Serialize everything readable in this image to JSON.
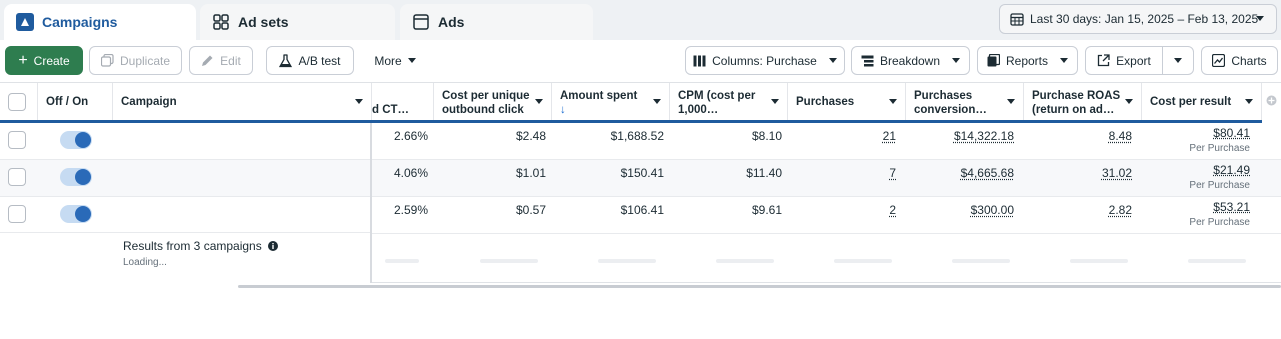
{
  "tabs": [
    {
      "label": "Campaigns",
      "icon": "campaign-icon",
      "active": true
    },
    {
      "label": "Ad sets",
      "icon": "grid-icon",
      "active": false
    },
    {
      "label": "Ads",
      "icon": "ad-icon",
      "active": false
    }
  ],
  "date_range": {
    "label": "Last 30 days: Jan 15, 2025 – Feb 13, 2025"
  },
  "toolbar": {
    "create": "Create",
    "duplicate": "Duplicate",
    "edit": "Edit",
    "ab_test": "A/B test",
    "more": "More",
    "columns": "Columns: Purchase",
    "breakdown": "Breakdown",
    "reports": "Reports",
    "export": "Export",
    "charts": "Charts"
  },
  "columns": {
    "off_on": "Off / On",
    "campaign": "Campaign",
    "ctr_partial": "d CT…",
    "cost_unique_line1": "Cost per unique",
    "cost_unique_line2": "outbound click",
    "amount_spent": "Amount spent",
    "amount_sort": "↓",
    "cpm_line1": "CPM (cost per",
    "cpm_line2": "1,000…",
    "purchases": "Purchases",
    "conv_line1": "Purchases",
    "conv_line2": "conversion…",
    "roas_line1": "Purchase ROAS",
    "roas_line2": "(return on ad…",
    "cost_per_result": "Cost per result"
  },
  "rows": [
    {
      "ctr": "2.66%",
      "cost_unique": "$2.48",
      "amount": "$1,688.52",
      "cpm": "$8.10",
      "purchases": "21",
      "conv_value": "$14,322.18",
      "roas": "8.48",
      "cpr": "$80.41",
      "cpr_sub": "Per Purchase"
    },
    {
      "ctr": "4.06%",
      "cost_unique": "$1.01",
      "amount": "$150.41",
      "cpm": "$11.40",
      "purchases": "7",
      "conv_value": "$4,665.68",
      "roas": "31.02",
      "cpr": "$21.49",
      "cpr_sub": "Per Purchase"
    },
    {
      "ctr": "2.59%",
      "cost_unique": "$0.57",
      "amount": "$106.41",
      "cpm": "$9.61",
      "purchases": "2",
      "conv_value": "$300.00",
      "roas": "2.82",
      "cpr": "$53.21",
      "cpr_sub": "Per Purchase"
    }
  ],
  "results": {
    "title": "Results from 3 campaigns",
    "status": "Loading..."
  },
  "colors": {
    "accent": "#1f5b9e",
    "create": "#2e7d4f",
    "toggle_on": "#2a6ab8"
  }
}
